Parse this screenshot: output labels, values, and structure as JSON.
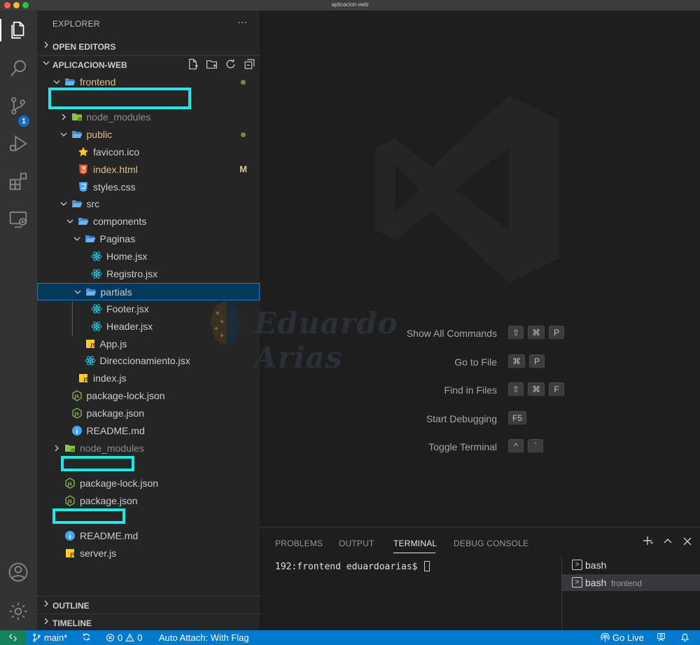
{
  "window": {
    "title": "aplicacion-web"
  },
  "colors": {
    "traffic_red": "#ff5f57",
    "traffic_yellow": "#febc2e",
    "traffic_green": "#28c840",
    "accent": "#007acc",
    "highlight_box": "#1de8e8",
    "modified": "#e2c08d"
  },
  "activity_bar": {
    "items": [
      "files-icon",
      "search-icon",
      "source-control-icon",
      "run-debug-icon",
      "extensions-icon",
      "remote-explorer-icon"
    ],
    "source_control_badge": "1",
    "bottom_items": [
      "account-icon",
      "settings-gear-icon"
    ]
  },
  "sidebar": {
    "header": "EXPLORER",
    "more": "···",
    "open_editors": "OPEN EDITORS",
    "workspace": "APLICACION-WEB",
    "outline": "OUTLINE",
    "timeline": "TIMELINE",
    "tree": [
      {
        "name": "frontend",
        "indent": 1,
        "type": "folder-open",
        "status": "modified-dot"
      },
      {
        "name": "node_modules",
        "indent": 2,
        "type": "folder-closed",
        "status": "ignored"
      },
      {
        "name": "public",
        "indent": 2,
        "type": "folder-open",
        "status": "modified-dot"
      },
      {
        "name": "favicon.ico",
        "indent": 3,
        "type": "favicon"
      },
      {
        "name": "index.html",
        "indent": 3,
        "type": "html",
        "status": "M"
      },
      {
        "name": "styles.css",
        "indent": 3,
        "type": "css"
      },
      {
        "name": "src",
        "indent": 2,
        "type": "folder-open"
      },
      {
        "name": "components",
        "indent": 3,
        "type": "folder-open"
      },
      {
        "name": "Paginas",
        "indent": 4,
        "type": "folder-open"
      },
      {
        "name": "Home.jsx",
        "indent": 5,
        "type": "react"
      },
      {
        "name": "Registro.jsx",
        "indent": 5,
        "type": "react"
      },
      {
        "name": "partials",
        "indent": 4,
        "type": "folder-open",
        "selected": true
      },
      {
        "name": "Footer.jsx",
        "indent": 5,
        "type": "react"
      },
      {
        "name": "Header.jsx",
        "indent": 5,
        "type": "react"
      },
      {
        "name": "App.js",
        "indent": 4,
        "type": "js"
      },
      {
        "name": "Direccionamiento.jsx",
        "indent": 4,
        "type": "react"
      },
      {
        "name": "index.js",
        "indent": 3,
        "type": "js"
      },
      {
        "name": "package-lock.json",
        "indent": 2,
        "type": "node"
      },
      {
        "name": "package.json",
        "indent": 2,
        "type": "node"
      },
      {
        "name": "README.md",
        "indent": 2,
        "type": "info"
      },
      {
        "name": "node_modules",
        "indent": 1,
        "type": "folder-closed",
        "status": "ignored"
      },
      {
        "name": "package-lock.json",
        "indent": 1,
        "type": "node"
      },
      {
        "name": "package.json",
        "indent": 1,
        "type": "node"
      },
      {
        "name": "README.md",
        "indent": 1,
        "type": "info"
      },
      {
        "name": "server.js",
        "indent": 1,
        "type": "js"
      }
    ]
  },
  "editor": {
    "watermark_text": "Eduardo Arias",
    "shortcuts": [
      {
        "label": "Show All Commands",
        "keys": [
          "⇧",
          "⌘",
          "P"
        ]
      },
      {
        "label": "Go to File",
        "keys": [
          "⌘",
          "P"
        ]
      },
      {
        "label": "Find in Files",
        "keys": [
          "⇧",
          "⌘",
          "F"
        ]
      },
      {
        "label": "Start Debugging",
        "keys": [
          "F5"
        ]
      },
      {
        "label": "Toggle Terminal",
        "keys": [
          "^",
          "`"
        ]
      }
    ]
  },
  "panel": {
    "tabs": [
      "PROBLEMS",
      "OUTPUT",
      "TERMINAL",
      "DEBUG CONSOLE"
    ],
    "active_tab": "TERMINAL",
    "prompt": "192:frontend eduardoarias$",
    "terminals": [
      {
        "name": "bash",
        "sub": ""
      },
      {
        "name": "bash",
        "sub": "frontend"
      }
    ]
  },
  "statusbar": {
    "branch": "main*",
    "errors": "0",
    "warnings": "0",
    "auto_attach": "Auto Attach: With Flag",
    "go_live": "Go Live"
  }
}
